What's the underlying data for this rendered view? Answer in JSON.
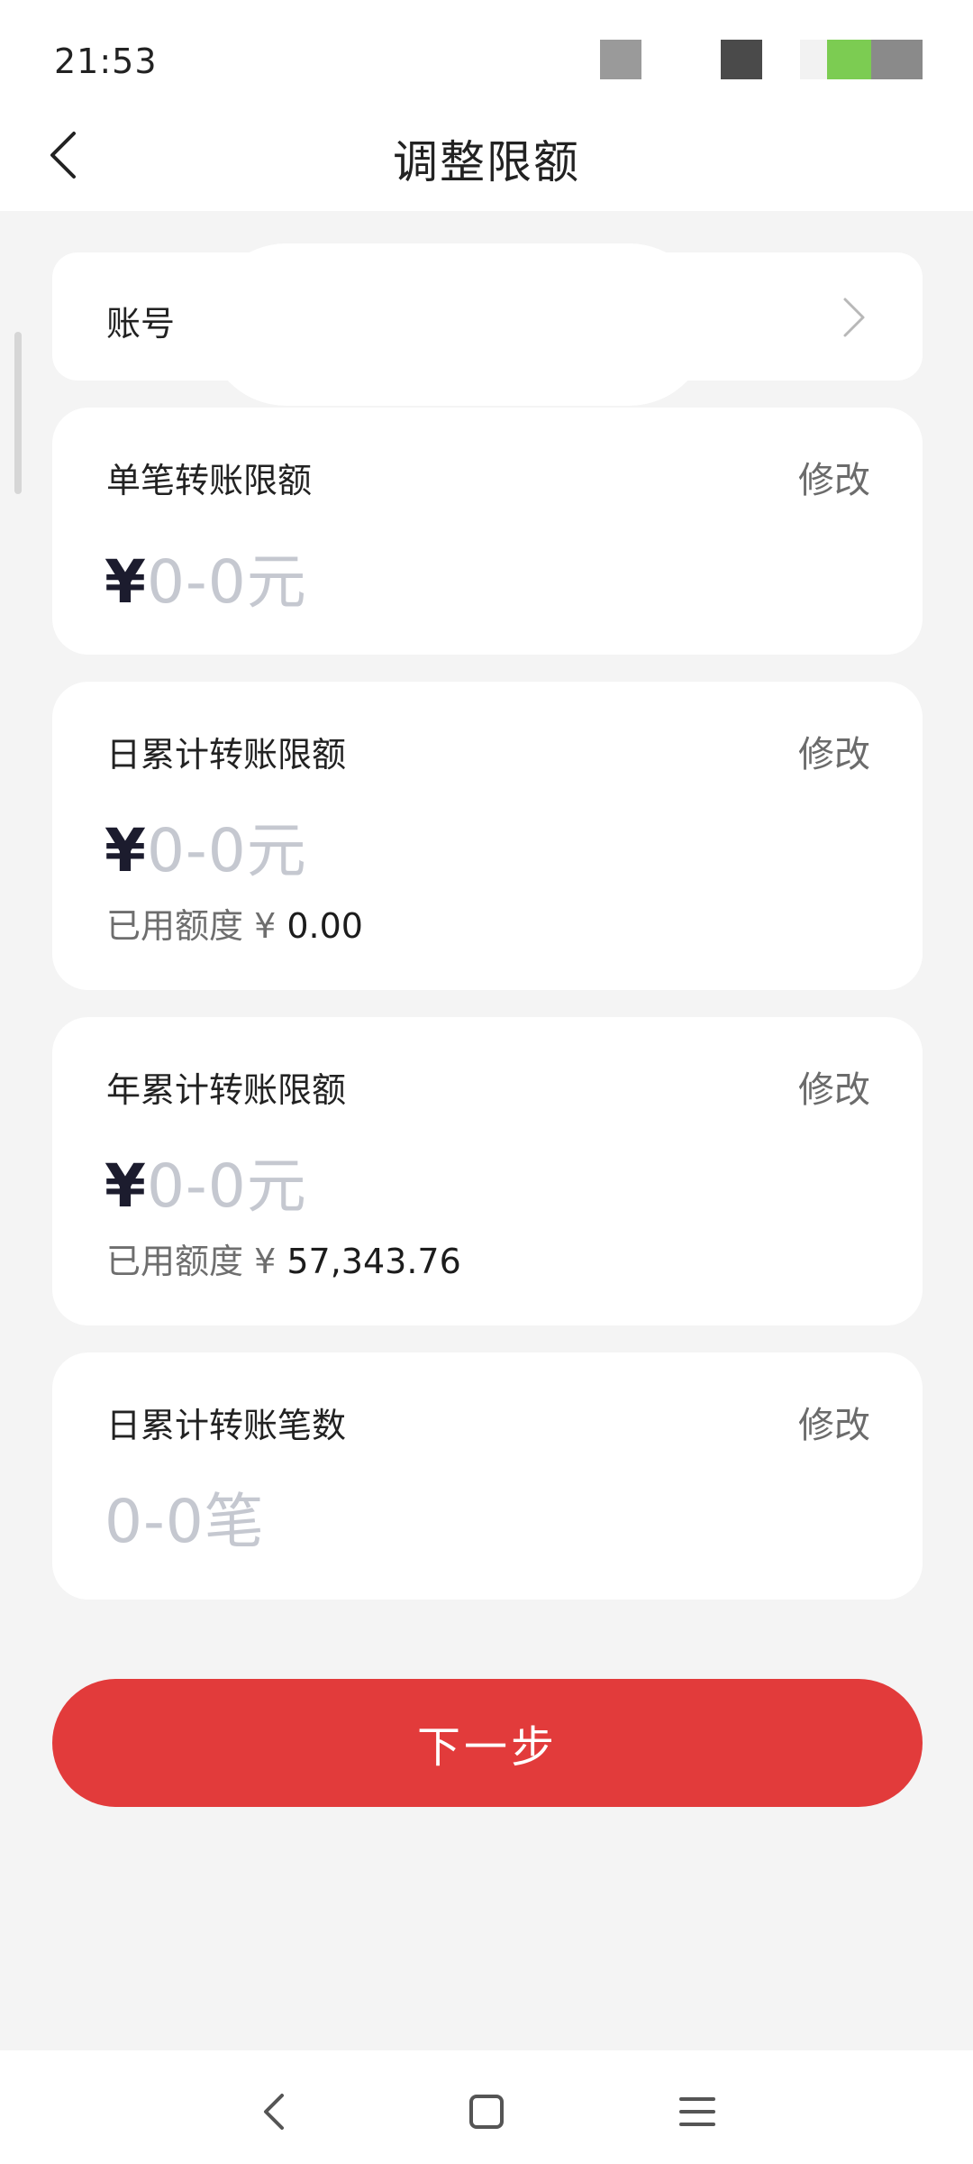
{
  "status_bar": {
    "time": "21:53"
  },
  "header": {
    "title": "调整限额"
  },
  "account": {
    "label": "账号"
  },
  "limits": [
    {
      "title": "单笔转账限额",
      "edit_label": "修改",
      "currency": "¥",
      "range": "0-0元"
    },
    {
      "title": "日累计转账限额",
      "edit_label": "修改",
      "currency": "¥",
      "range": "0-0元",
      "used_label": "已用额度 ¥",
      "used_amount": "0.00"
    },
    {
      "title": "年累计转账限额",
      "edit_label": "修改",
      "currency": "¥",
      "range": "0-0元",
      "used_label": "已用额度 ¥",
      "used_amount": "57,343.76"
    },
    {
      "title": "日累计转账笔数",
      "edit_label": "修改",
      "range": "0-0笔"
    }
  ],
  "next_button": {
    "label": "下一步"
  },
  "colors": {
    "accent": "#e23b3b",
    "placeholder": "#c5c8d0",
    "background": "#f4f4f4"
  }
}
